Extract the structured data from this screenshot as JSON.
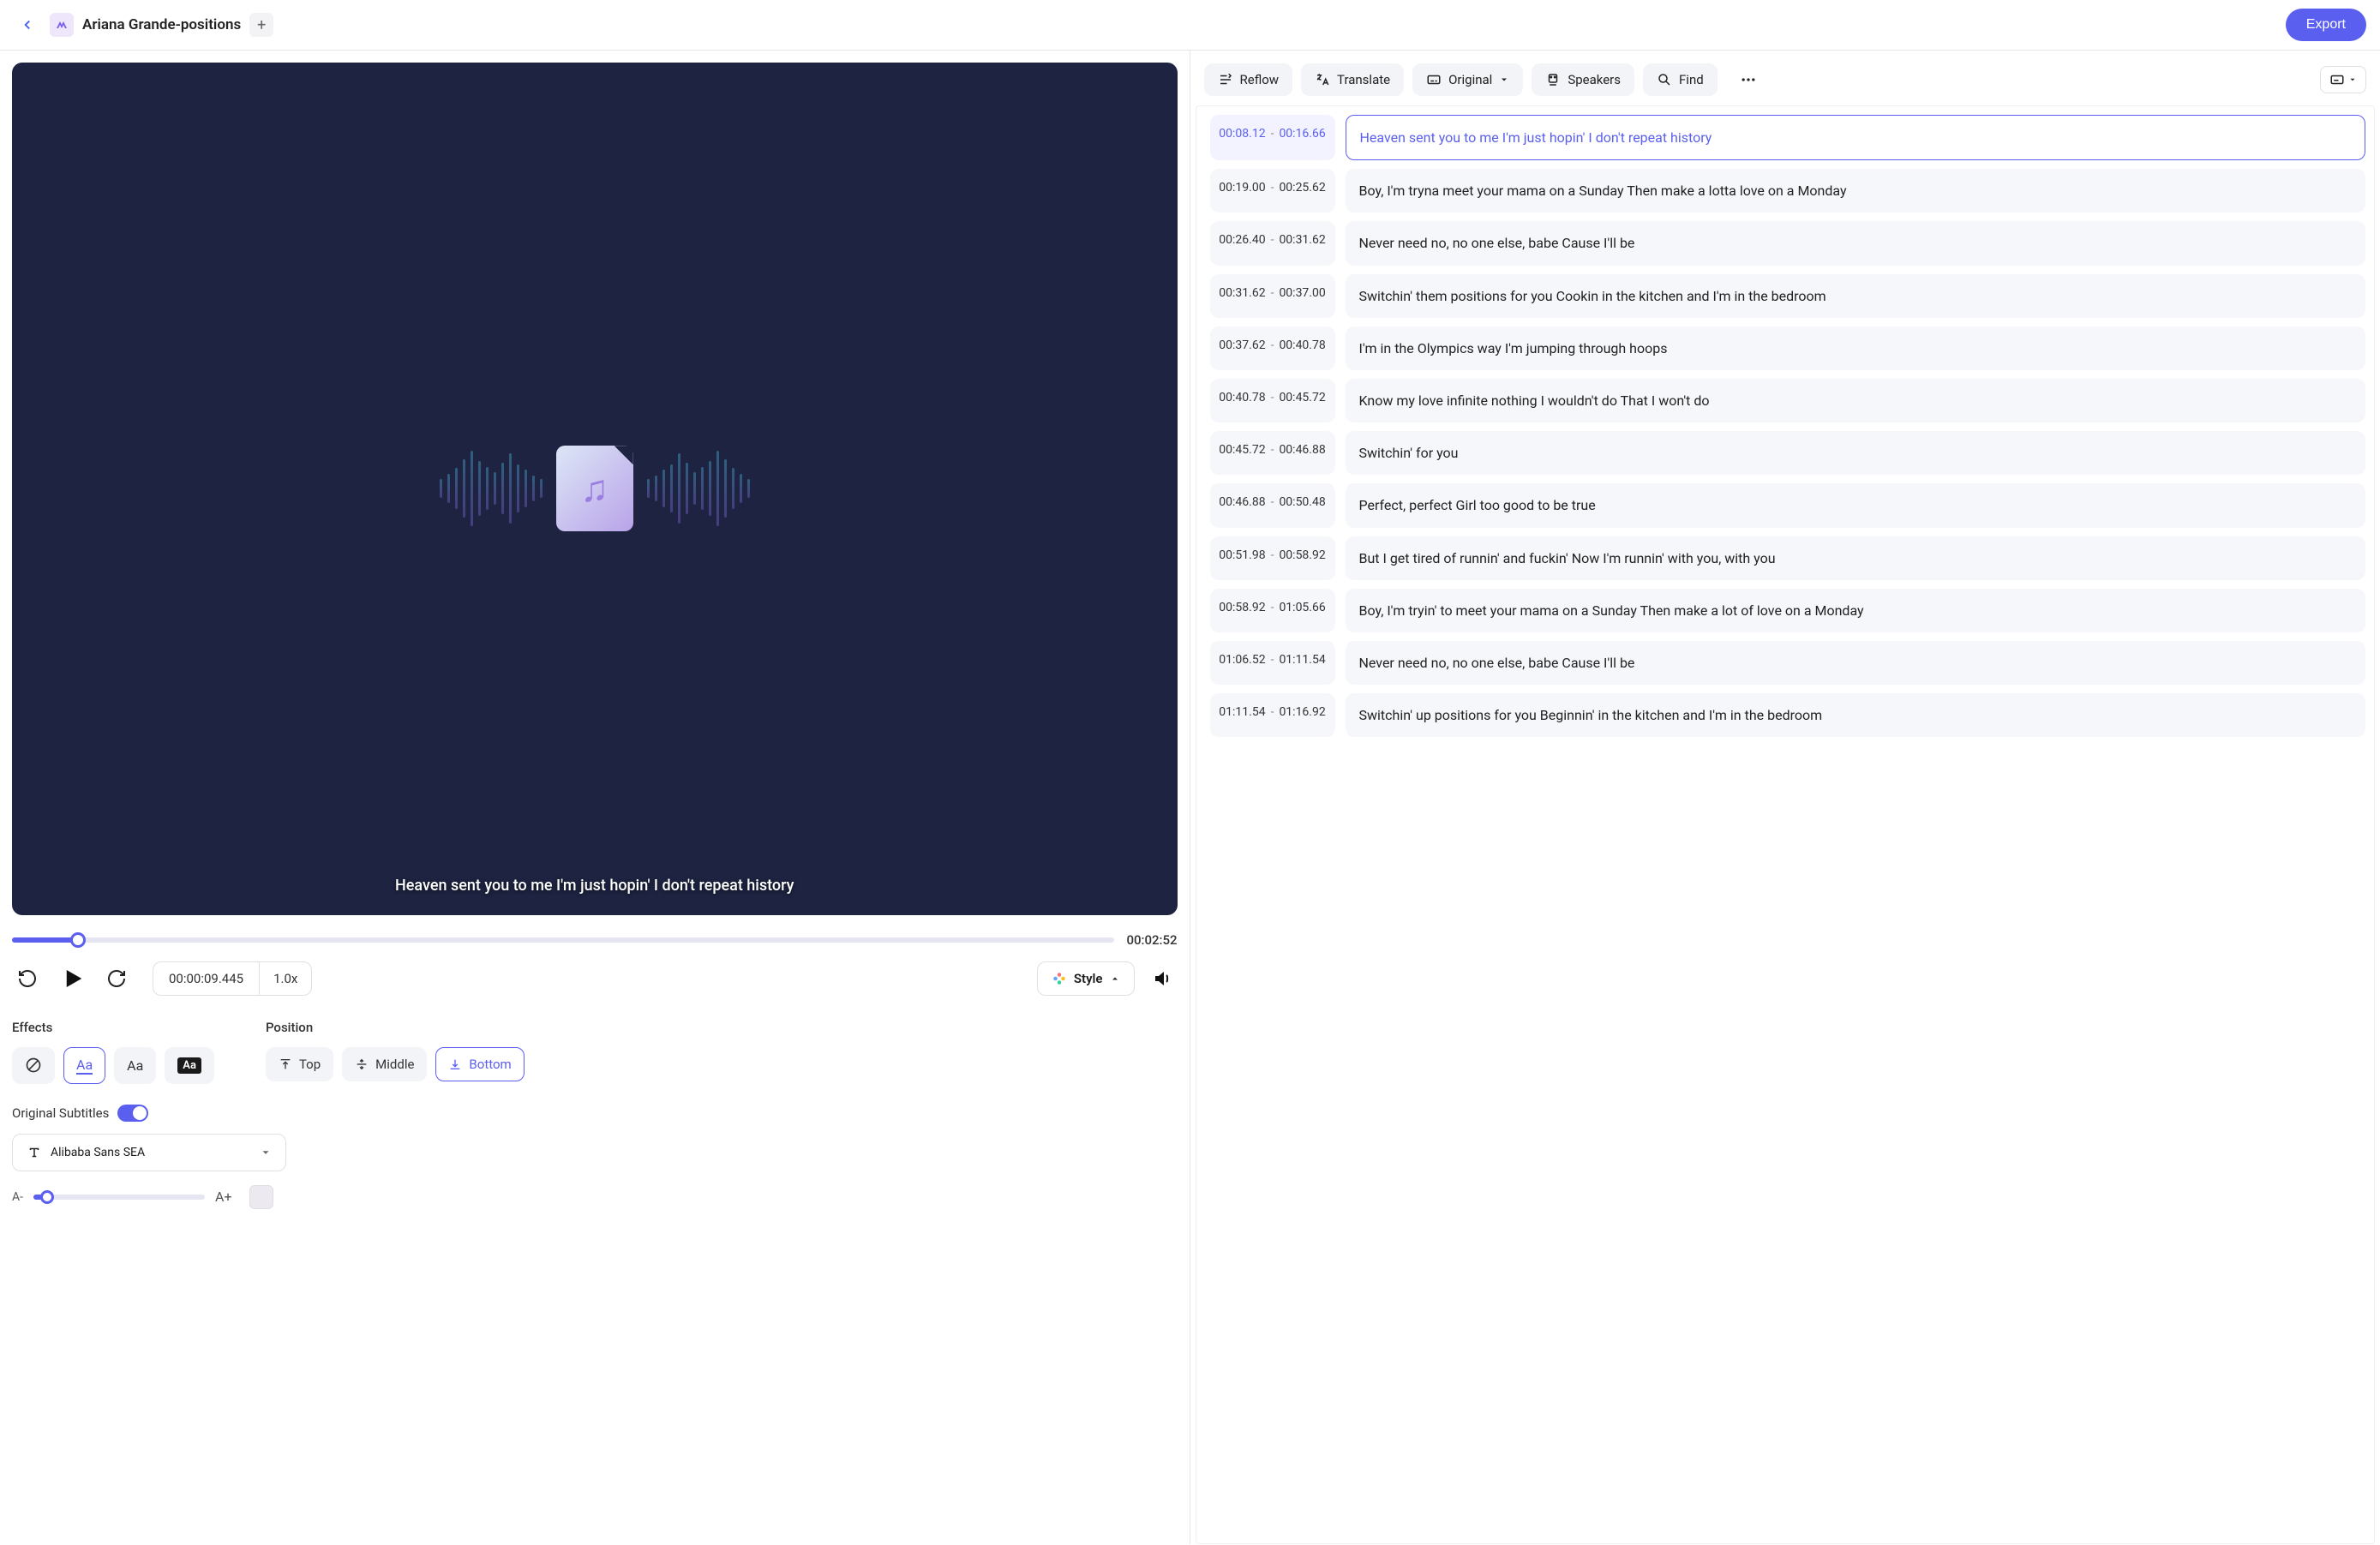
{
  "header": {
    "project_title": "Ariana Grande-positions",
    "export_label": "Export"
  },
  "preview": {
    "caption_text": "Heaven sent you to me I'm just hopin' I don't repeat history",
    "total_duration": "00:02:52",
    "current_time": "00:00:09.445",
    "playback_speed": "1.0x",
    "style_label": "Style"
  },
  "effects": {
    "section_label": "Effects",
    "selected_index": 1
  },
  "position": {
    "section_label": "Position",
    "options": [
      "Top",
      "Middle",
      "Bottom"
    ],
    "selected_index": 2
  },
  "subtitles": {
    "toggle_label": "Original Subtitles",
    "toggle_on": true,
    "font_name": "Alibaba Sans SEA",
    "size_minus": "A-",
    "size_plus": "A+"
  },
  "toolbar": {
    "reflow": "Reflow",
    "translate": "Translate",
    "original": "Original",
    "speakers": "Speakers",
    "find": "Find"
  },
  "transcript": [
    {
      "start": "00:08.12",
      "end": "00:16.66",
      "text": "Heaven sent you to me I'm just hopin' I don't repeat history",
      "active": true
    },
    {
      "start": "00:19.00",
      "end": "00:25.62",
      "text": "Boy, I'm tryna meet your mama on a Sunday Then make a lotta love on a Monday"
    },
    {
      "start": "00:26.40",
      "end": "00:31.62",
      "text": "Never need no, no one else, babe Cause I'll be"
    },
    {
      "start": "00:31.62",
      "end": "00:37.00",
      "text": "Switchin' them positions for you Cookin in the kitchen and I'm in the bedroom"
    },
    {
      "start": "00:37.62",
      "end": "00:40.78",
      "text": "I'm in the Olympics way I'm jumping  through hoops"
    },
    {
      "start": "00:40.78",
      "end": "00:45.72",
      "text": "Know my love infinite nothing I wouldn't do That I won't do"
    },
    {
      "start": "00:45.72",
      "end": "00:46.88",
      "text": "Switchin' for you"
    },
    {
      "start": "00:46.88",
      "end": "00:50.48",
      "text": "Perfect, perfect Girl too good to be true"
    },
    {
      "start": "00:51.98",
      "end": "00:58.92",
      "text": "But I get tired of runnin' and fuckin' Now I'm runnin' with you, with you"
    },
    {
      "start": "00:58.92",
      "end": "01:05.66",
      "text": "Boy, I'm tryin' to meet your mama on a Sunday Then make a lot of love on a Monday"
    },
    {
      "start": "01:06.52",
      "end": "01:11.54",
      "text": "Never need no, no one else, babe Cause I'll be"
    },
    {
      "start": "01:11.54",
      "end": "01:16.92",
      "text": "Switchin' up positions for you Beginnin' in the kitchen and I'm in the bedroom"
    }
  ]
}
